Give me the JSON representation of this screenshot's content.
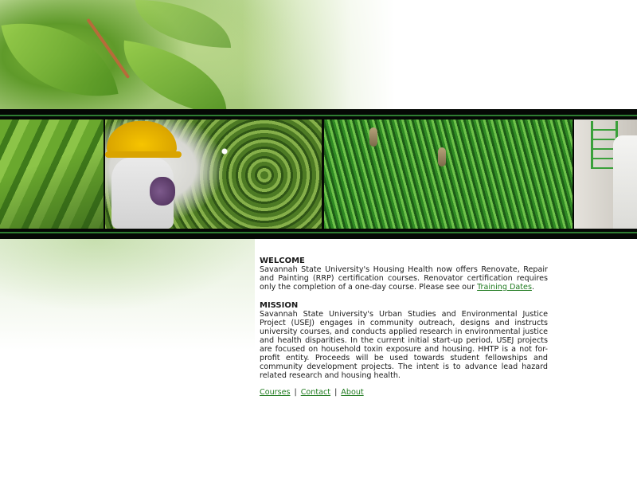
{
  "welcome": {
    "heading": "WELCOME",
    "text": "Savannah State University's Housing Health now offers Renovate, Repair and Painting (RRP) certification courses. Renovator certification requires only the completion of a one-day course. Please see our ",
    "link": "Training Dates",
    "end": "."
  },
  "mission": {
    "heading": "MISSION",
    "text": "Savannah State University's Urban Studies and Environmental Justice Project (USEJ) engages in community outreach, designs and instructs university courses, and conducts applied research in environmental justice and health disparities. In the current initial start-up period, USEJ projects are focused on household toxin exposure and housing. HHTP is a not for-profit entity. Proceeds will be used towards student fellowships and community development projects. The intent is to advance lead hazard related research and housing health."
  },
  "nav": {
    "courses": "Courses",
    "contact": "Contact",
    "about": "About",
    "separator": "|"
  },
  "colors": {
    "link": "#1f7a1f",
    "strip": "#050805",
    "accent_green": "#2e7d32"
  }
}
